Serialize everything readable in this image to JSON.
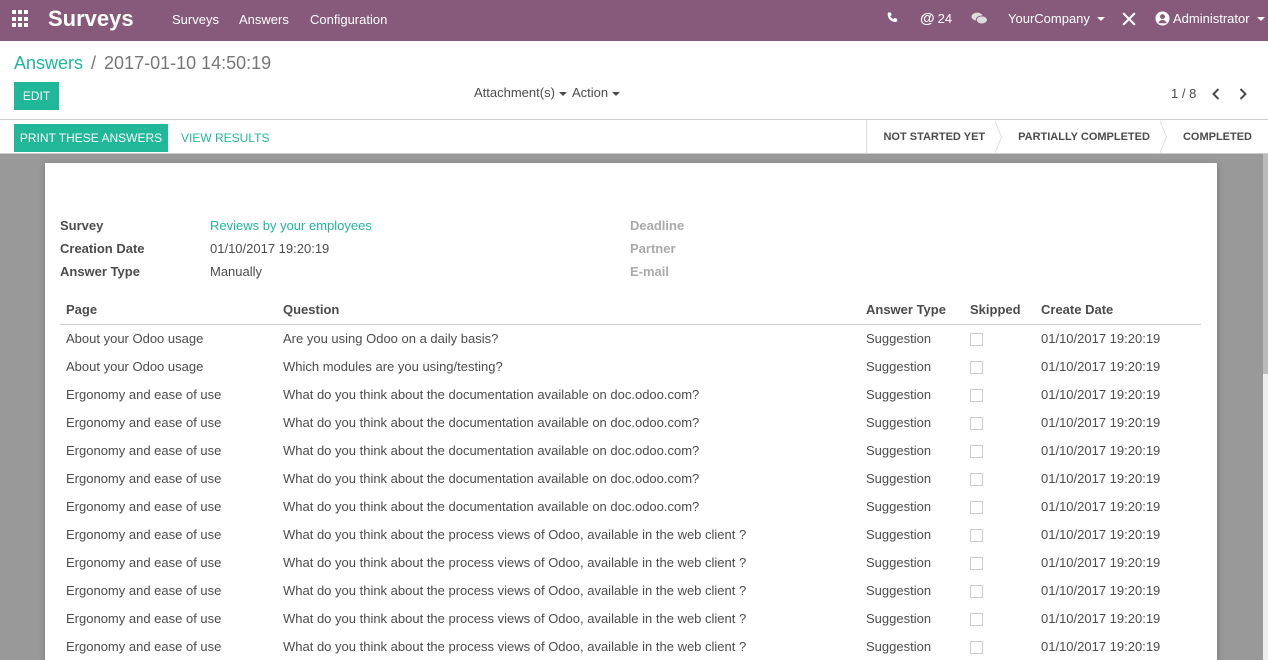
{
  "navbar": {
    "brand": "Surveys",
    "menus": [
      "Surveys",
      "Answers",
      "Configuration"
    ],
    "mention_count": "24",
    "company": "YourCompany",
    "user": "Administrator"
  },
  "breadcrumb": {
    "parent": "Answers",
    "separator": "/",
    "current": "2017-01-10 14:50:19"
  },
  "buttons": {
    "edit": "EDIT",
    "attachments": "Attachment(s)",
    "action": "Action",
    "print": "PRINT THESE ANSWERS",
    "view_results": "VIEW RESULTS"
  },
  "pager": {
    "text": "1 / 8"
  },
  "stages": [
    "NOT STARTED YET",
    "PARTIALLY COMPLETED",
    "COMPLETED"
  ],
  "form": {
    "survey_label": "Survey",
    "survey_value": "Reviews by your employees",
    "creation_date_label": "Creation Date",
    "creation_date_value": "01/10/2017 19:20:19",
    "answer_type_label": "Answer Type",
    "answer_type_value": "Manually",
    "deadline_label": "Deadline",
    "partner_label": "Partner",
    "email_label": "E-mail"
  },
  "table": {
    "headers": [
      "Page",
      "Question",
      "Answer Type",
      "Skipped",
      "Create Date"
    ],
    "rows": [
      [
        "About your Odoo usage",
        "Are you using Odoo on a daily basis?",
        "Suggestion",
        "",
        "01/10/2017 19:20:19"
      ],
      [
        "About your Odoo usage",
        "Which modules are you using/testing?",
        "Suggestion",
        "",
        "01/10/2017 19:20:19"
      ],
      [
        "Ergonomy and ease of use",
        "What do you think about the documentation available on doc.odoo.com?",
        "Suggestion",
        "",
        "01/10/2017 19:20:19"
      ],
      [
        "Ergonomy and ease of use",
        "What do you think about the documentation available on doc.odoo.com?",
        "Suggestion",
        "",
        "01/10/2017 19:20:19"
      ],
      [
        "Ergonomy and ease of use",
        "What do you think about the documentation available on doc.odoo.com?",
        "Suggestion",
        "",
        "01/10/2017 19:20:19"
      ],
      [
        "Ergonomy and ease of use",
        "What do you think about the documentation available on doc.odoo.com?",
        "Suggestion",
        "",
        "01/10/2017 19:20:19"
      ],
      [
        "Ergonomy and ease of use",
        "What do you think about the documentation available on doc.odoo.com?",
        "Suggestion",
        "",
        "01/10/2017 19:20:19"
      ],
      [
        "Ergonomy and ease of use",
        "What do you think about the process views of Odoo, available in the web client ?",
        "Suggestion",
        "",
        "01/10/2017 19:20:19"
      ],
      [
        "Ergonomy and ease of use",
        "What do you think about the process views of Odoo, available in the web client ?",
        "Suggestion",
        "",
        "01/10/2017 19:20:19"
      ],
      [
        "Ergonomy and ease of use",
        "What do you think about the process views of Odoo, available in the web client ?",
        "Suggestion",
        "",
        "01/10/2017 19:20:19"
      ],
      [
        "Ergonomy and ease of use",
        "What do you think about the process views of Odoo, available in the web client ?",
        "Suggestion",
        "",
        "01/10/2017 19:20:19"
      ],
      [
        "Ergonomy and ease of use",
        "What do you think about the process views of Odoo, available in the web client ?",
        "Suggestion",
        "",
        "01/10/2017 19:20:19"
      ]
    ]
  },
  "colors": {
    "navbar": "#875a7b",
    "accent": "#21b799",
    "background": "#999999"
  },
  "icons": [
    "apps-grid-icon",
    "phone-icon",
    "at-icon",
    "chat-icon",
    "debug-icon",
    "user-avatar-icon",
    "chevron-left-icon",
    "chevron-right-icon"
  ]
}
